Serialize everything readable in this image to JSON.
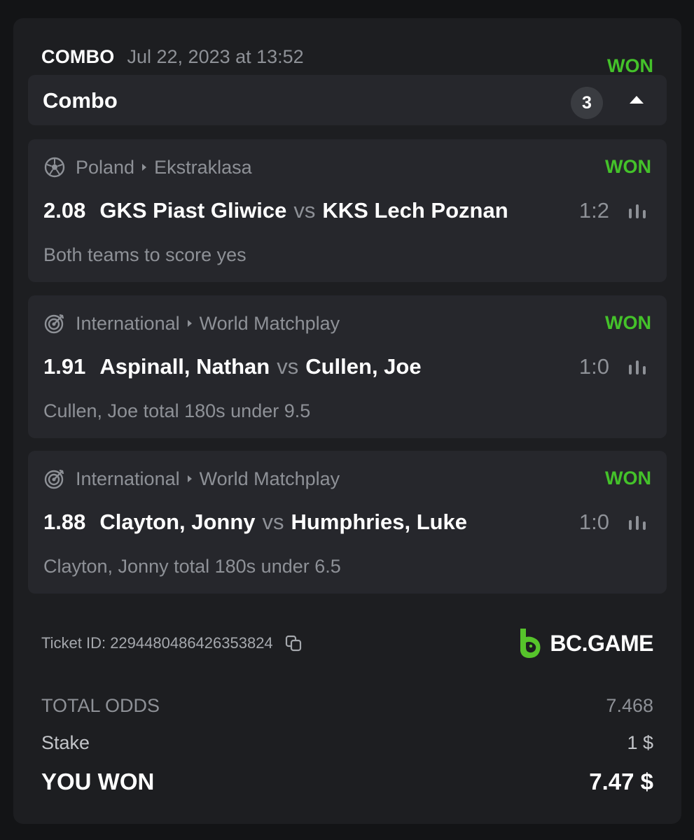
{
  "header": {
    "type": "COMBO",
    "date": "Jul 22, 2023 at 13:52",
    "status": "WON"
  },
  "combo": {
    "title": "Combo",
    "count": "3"
  },
  "legs": [
    {
      "sport_icon": "soccer-ball-icon",
      "country": "Poland",
      "league": "Ekstraklasa",
      "status": "WON",
      "odds": "2.08",
      "home": "GKS Piast Gliwice",
      "vs": "vs",
      "away": "KKS Lech Poznan",
      "score": "1:2",
      "market": "Both teams to score yes"
    },
    {
      "sport_icon": "darts-target-icon",
      "country": "International",
      "league": "World Matchplay",
      "status": "WON",
      "odds": "1.91",
      "home": "Aspinall, Nathan",
      "vs": "vs",
      "away": "Cullen, Joe",
      "score": "1:0",
      "market": "Cullen, Joe total 180s under 9.5"
    },
    {
      "sport_icon": "darts-target-icon",
      "country": "International",
      "league": "World Matchplay",
      "status": "WON",
      "odds": "1.88",
      "home": "Clayton, Jonny",
      "vs": "vs",
      "away": "Humphries, Luke",
      "score": "1:0",
      "market": "Clayton, Jonny total 180s under 6.5"
    }
  ],
  "ticket": {
    "label": "Ticket ID: 2294480486426353824"
  },
  "brand": {
    "name": "BC.GAME",
    "color": "#56c42b"
  },
  "summary": {
    "total_odds_label": "TOTAL ODDS",
    "total_odds_value": "7.468",
    "stake_label": "Stake",
    "stake_value": "1 $",
    "won_label": "YOU WON",
    "won_value": "7.47 $"
  },
  "colors": {
    "won": "#44c22a",
    "background": "#131416",
    "card": "#1d1e21",
    "panel": "#26272c",
    "muted": "#8e9197"
  }
}
